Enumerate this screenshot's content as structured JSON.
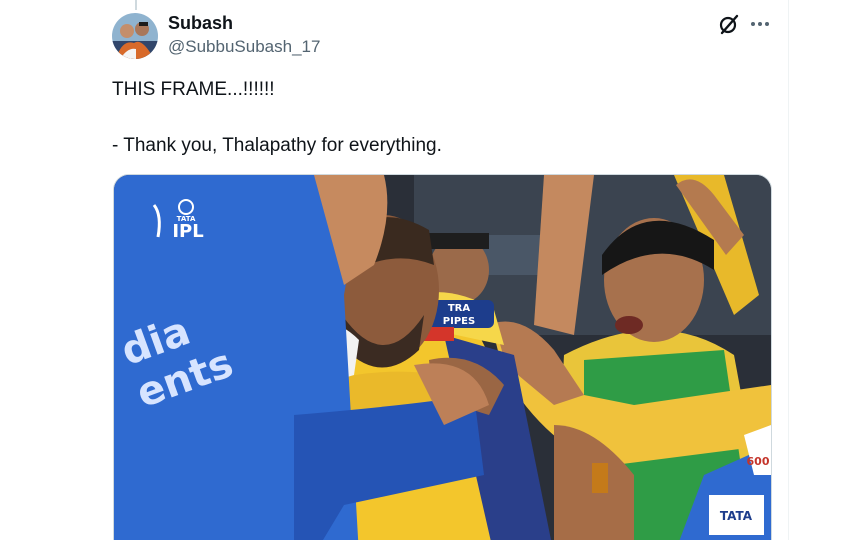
{
  "user": {
    "display_name": "Subash",
    "handle": "@SubbuSubash_17",
    "avatar_icon": "avatar-photo"
  },
  "tweet": {
    "line1": "THIS FRAME...!!!!!!",
    "line2": "- Thank you, Thalapathy for everything."
  },
  "actions": {
    "grok_icon": "grok-icon",
    "more_icon": "more-options-icon"
  },
  "media": {
    "logo_top": "TATA",
    "logo_main": "IPL",
    "jersey_text_1": "dia",
    "jersey_text_2": "ents",
    "badge_text_1": "TRA",
    "badge_text_2": "PIPES",
    "sleeve_text": "TATA",
    "corner_text": "600"
  },
  "colors": {
    "text_primary": "#0f1419",
    "text_secondary": "#536471",
    "divider": "#eff3f4",
    "blue_jersey": "#2f6ad0",
    "yellow_jersey": "#f3c62c",
    "green_vest": "#2f9c46"
  }
}
